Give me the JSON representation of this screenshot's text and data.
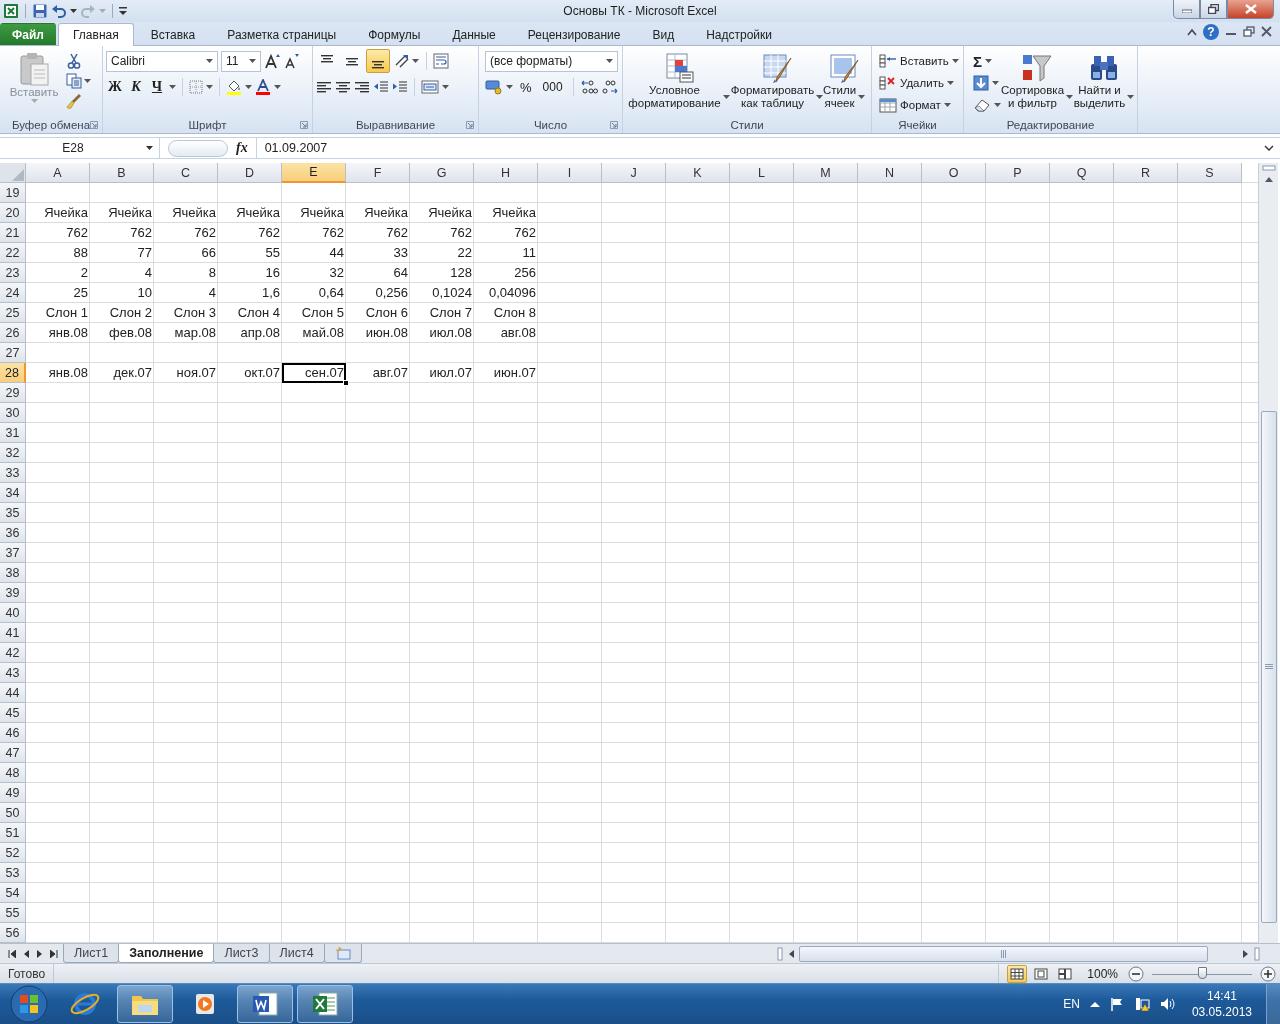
{
  "window": {
    "title": "Основы ТК - Microsoft Excel"
  },
  "ribbon_tabs": [
    {
      "label": "Файл",
      "kind": "file",
      "selected": false
    },
    {
      "label": "Главная",
      "kind": "tab",
      "selected": true
    },
    {
      "label": "Вставка",
      "kind": "tab",
      "selected": false
    },
    {
      "label": "Разметка страницы",
      "kind": "tab",
      "selected": false
    },
    {
      "label": "Формулы",
      "kind": "tab",
      "selected": false
    },
    {
      "label": "Данные",
      "kind": "tab",
      "selected": false
    },
    {
      "label": "Рецензирование",
      "kind": "tab",
      "selected": false
    },
    {
      "label": "Вид",
      "kind": "tab",
      "selected": false
    },
    {
      "label": "Надстройки",
      "kind": "tab",
      "selected": false
    }
  ],
  "help": "?",
  "ribbon": {
    "clipboard": {
      "label": "Буфер обмена",
      "paste": {
        "label": "Вставить",
        "disabled": true
      }
    },
    "font": {
      "label": "Шрифт",
      "font_name": "Calibri",
      "font_size": "11",
      "bold": "Ж",
      "italic": "К",
      "underline": "Ч"
    },
    "alignment": {
      "label": "Выравнивание",
      "vertical": [
        {
          "selected": false
        },
        {
          "selected": false
        },
        {
          "selected": true
        }
      ]
    },
    "number": {
      "label": "Число",
      "format": "(все форматы)",
      "percent": "%",
      "thousands": "000"
    },
    "styles": {
      "label": "Стили",
      "conditional": "Условное\nформатирование",
      "as_table": "Форматировать\nкак таблицу",
      "cell_styles": "Стили\nячеек"
    },
    "cells": {
      "label": "Ячейки",
      "insert": "Вставить",
      "delete": "Удалить",
      "format": "Формат"
    },
    "editing": {
      "label": "Редактирование",
      "autosum": "Σ",
      "sort": "Сортировка\nи фильтр",
      "find": "Найти и\nвыделить"
    }
  },
  "formula_bar": {
    "name_box": "E28",
    "fx": "fx",
    "formula": "01.09.2007"
  },
  "grid": {
    "columns": [
      {
        "label": "A",
        "selected": false
      },
      {
        "label": "B",
        "selected": false
      },
      {
        "label": "C",
        "selected": false
      },
      {
        "label": "D",
        "selected": false
      },
      {
        "label": "E",
        "selected": true
      },
      {
        "label": "F",
        "selected": false
      },
      {
        "label": "G",
        "selected": false
      },
      {
        "label": "H",
        "selected": false
      },
      {
        "label": "I",
        "selected": false
      },
      {
        "label": "J",
        "selected": false
      },
      {
        "label": "K",
        "selected": false
      },
      {
        "label": "L",
        "selected": false
      },
      {
        "label": "M",
        "selected": false
      },
      {
        "label": "N",
        "selected": false
      },
      {
        "label": "O",
        "selected": false
      },
      {
        "label": "P",
        "selected": false
      },
      {
        "label": "Q",
        "selected": false
      },
      {
        "label": "R",
        "selected": false
      },
      {
        "label": "S",
        "selected": false
      }
    ],
    "rows": [
      {
        "header": "19",
        "selected": false
      },
      {
        "header": "20",
        "selected": false,
        "cells": [
          {
            "text": "Ячейка",
            "selected": false
          },
          {
            "text": "Ячейка",
            "selected": false
          },
          {
            "text": "Ячейка",
            "selected": false
          },
          {
            "text": "Ячейка",
            "selected": false
          },
          {
            "text": "Ячейка",
            "selected": false
          },
          {
            "text": "Ячейка",
            "selected": false
          },
          {
            "text": "Ячейка",
            "selected": false
          },
          {
            "text": "Ячейка",
            "selected": false
          }
        ]
      },
      {
        "header": "21",
        "selected": false,
        "cells": [
          {
            "text": "762",
            "selected": false
          },
          {
            "text": "762",
            "selected": false
          },
          {
            "text": "762",
            "selected": false
          },
          {
            "text": "762",
            "selected": false
          },
          {
            "text": "762",
            "selected": false
          },
          {
            "text": "762",
            "selected": false
          },
          {
            "text": "762",
            "selected": false
          },
          {
            "text": "762",
            "selected": false
          }
        ]
      },
      {
        "header": "22",
        "selected": false,
        "cells": [
          {
            "text": "88",
            "selected": false
          },
          {
            "text": "77",
            "selected": false
          },
          {
            "text": "66",
            "selected": false
          },
          {
            "text": "55",
            "selected": false
          },
          {
            "text": "44",
            "selected": false
          },
          {
            "text": "33",
            "selected": false
          },
          {
            "text": "22",
            "selected": false
          },
          {
            "text": "11",
            "selected": false
          }
        ]
      },
      {
        "header": "23",
        "selected": false,
        "cells": [
          {
            "text": "2",
            "selected": false
          },
          {
            "text": "4",
            "selected": false
          },
          {
            "text": "8",
            "selected": false
          },
          {
            "text": "16",
            "selected": false
          },
          {
            "text": "32",
            "selected": false
          },
          {
            "text": "64",
            "selected": false
          },
          {
            "text": "128",
            "selected": false
          },
          {
            "text": "256",
            "selected": false
          }
        ]
      },
      {
        "header": "24",
        "selected": false,
        "cells": [
          {
            "text": "25",
            "selected": false
          },
          {
            "text": "10",
            "selected": false
          },
          {
            "text": "4",
            "selected": false
          },
          {
            "text": "1,6",
            "selected": false
          },
          {
            "text": "0,64",
            "selected": false
          },
          {
            "text": "0,256",
            "selected": false
          },
          {
            "text": "0,1024",
            "selected": false
          },
          {
            "text": "0,04096",
            "selected": false
          }
        ]
      },
      {
        "header": "25",
        "selected": false,
        "cells": [
          {
            "text": "Слон 1",
            "selected": false
          },
          {
            "text": "Слон 2",
            "selected": false
          },
          {
            "text": "Слон 3",
            "selected": false
          },
          {
            "text": "Слон 4",
            "selected": false
          },
          {
            "text": "Слон 5",
            "selected": false
          },
          {
            "text": "Слон 6",
            "selected": false
          },
          {
            "text": "Слон 7",
            "selected": false
          },
          {
            "text": "Слон 8",
            "selected": false
          }
        ]
      },
      {
        "header": "26",
        "selected": false,
        "cells": [
          {
            "text": "янв.08",
            "selected": false
          },
          {
            "text": "фев.08",
            "selected": false
          },
          {
            "text": "мар.08",
            "selected": false
          },
          {
            "text": "апр.08",
            "selected": false
          },
          {
            "text": "май.08",
            "selected": false
          },
          {
            "text": "июн.08",
            "selected": false
          },
          {
            "text": "июл.08",
            "selected": false
          },
          {
            "text": "авг.08",
            "selected": false
          }
        ]
      },
      {
        "header": "27",
        "selected": false
      },
      {
        "header": "28",
        "selected": true,
        "cells": [
          {
            "text": "янв.08",
            "selected": false
          },
          {
            "text": "дек.07",
            "selected": false
          },
          {
            "text": "ноя.07",
            "selected": false
          },
          {
            "text": "окт.07",
            "selected": false
          },
          {
            "text": "сен.07",
            "selected": true
          },
          {
            "text": "авг.07",
            "selected": false
          },
          {
            "text": "июл.07",
            "selected": false
          },
          {
            "text": "июн.07",
            "selected": false
          }
        ]
      },
      {
        "header": "29",
        "selected": false
      },
      {
        "header": "30",
        "selected": false
      },
      {
        "header": "31",
        "selected": false
      },
      {
        "header": "32",
        "selected": false
      },
      {
        "header": "33",
        "selected": false
      },
      {
        "header": "34",
        "selected": false
      },
      {
        "header": "35",
        "selected": false
      },
      {
        "header": "36",
        "selected": false
      },
      {
        "header": "37",
        "selected": false
      },
      {
        "header": "38",
        "selected": false
      },
      {
        "header": "39",
        "selected": false
      },
      {
        "header": "40",
        "selected": false
      },
      {
        "header": "41",
        "selected": false
      },
      {
        "header": "42",
        "selected": false
      },
      {
        "header": "43",
        "selected": false
      },
      {
        "header": "44",
        "selected": false
      },
      {
        "header": "45",
        "selected": false
      },
      {
        "header": "46",
        "selected": false
      },
      {
        "header": "47",
        "selected": false
      },
      {
        "header": "48",
        "selected": false
      },
      {
        "header": "49",
        "selected": false
      },
      {
        "header": "50",
        "selected": false
      },
      {
        "header": "51",
        "selected": false
      },
      {
        "header": "52",
        "selected": false
      },
      {
        "header": "53",
        "selected": false
      },
      {
        "header": "54",
        "selected": false
      },
      {
        "header": "55",
        "selected": false
      },
      {
        "header": "56",
        "selected": false
      }
    ]
  },
  "sheets": [
    {
      "label": "Лист1",
      "selected": false
    },
    {
      "label": "Заполнение",
      "selected": true
    },
    {
      "label": "Лист3",
      "selected": false
    },
    {
      "label": "Лист4",
      "selected": false
    }
  ],
  "status_bar": {
    "status": "Готово",
    "views": [
      {
        "selected": true
      },
      {
        "selected": false
      },
      {
        "selected": false
      }
    ],
    "zoom": "100%",
    "zoom_slider": {
      "level": 0.5
    }
  },
  "taskbar": {
    "apps": [
      {
        "kind": "ie",
        "running": false
      },
      {
        "kind": "explorer",
        "running": true
      },
      {
        "kind": "media",
        "running": false
      },
      {
        "kind": "word",
        "running": true
      },
      {
        "kind": "excel",
        "running": true
      }
    ],
    "language": "EN",
    "time": "14:41",
    "date": "03.05.2013"
  }
}
